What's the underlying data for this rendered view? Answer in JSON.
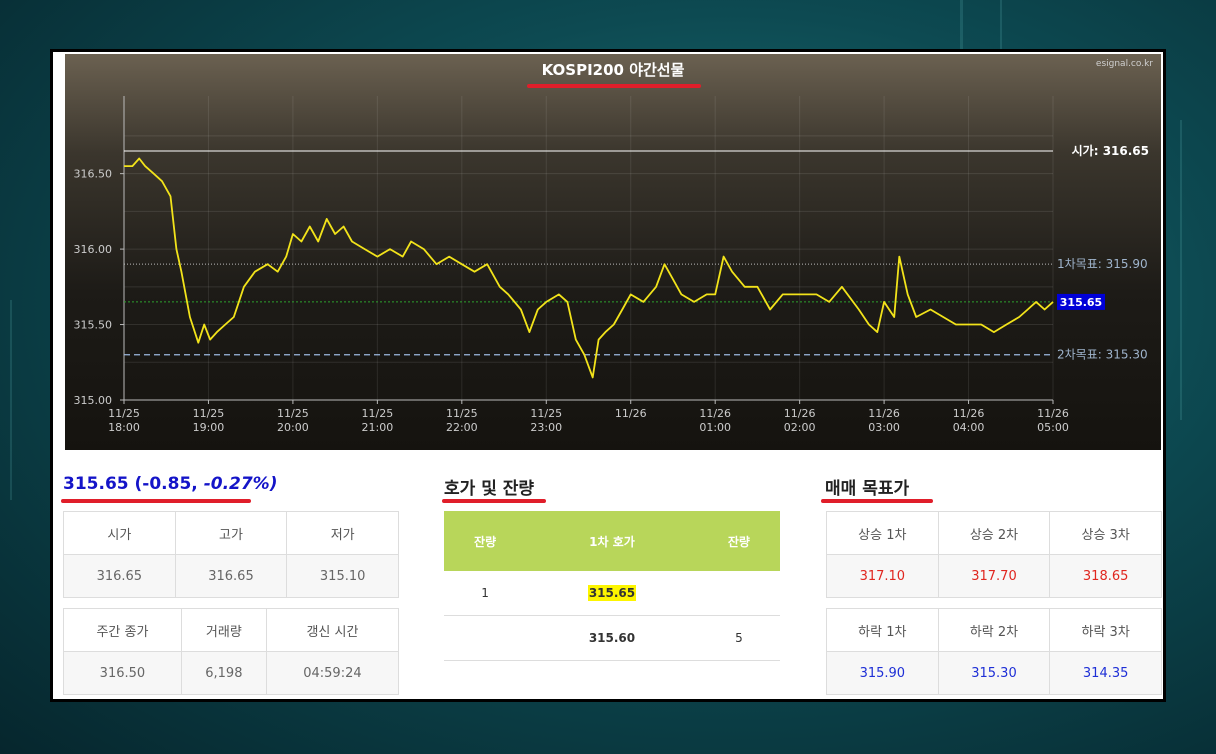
{
  "chart": {
    "title": "KOSPI200 야간선물",
    "source": "esignal.co.kr",
    "x_labels": [
      [
        "11/25",
        "18:00"
      ],
      [
        "11/25",
        "19:00"
      ],
      [
        "11/25",
        "20:00"
      ],
      [
        "11/25",
        "21:00"
      ],
      [
        "11/25",
        "22:00"
      ],
      [
        "11/25",
        "23:00"
      ],
      [
        "11/26",
        ""
      ],
      [
        "11/26",
        "01:00"
      ],
      [
        "11/26",
        "02:00"
      ],
      [
        "11/26",
        "03:00"
      ],
      [
        "11/26",
        "04:00"
      ],
      [
        "11/26",
        "05:00"
      ]
    ],
    "y_labels": [
      "316.50",
      "316.00",
      "315.50",
      "315.00"
    ],
    "ref_lines": {
      "open_label": "시가:",
      "open_value": "316.65",
      "target1_label": "1차목표:",
      "target1_value": "315.90",
      "target2_label": "2차목표:",
      "target2_value": "315.30",
      "current_badge": "315.65"
    },
    "colors": {
      "line": "#f2e31a",
      "current": "#0000d8",
      "open_line": "#ffffff",
      "target2_line": "#9cb8e0"
    }
  },
  "chart_data": {
    "type": "line",
    "title": "KOSPI200 야간선물",
    "x_range_hours": [
      18,
      29
    ],
    "ylim": [
      315.0,
      316.65
    ],
    "series": [
      {
        "values": [
          [
            18.0,
            316.55
          ],
          [
            18.1,
            316.55
          ],
          [
            18.18,
            316.6
          ],
          [
            18.25,
            316.55
          ],
          [
            18.35,
            316.5
          ],
          [
            18.45,
            316.45
          ],
          [
            18.55,
            316.35
          ],
          [
            18.62,
            316.0
          ],
          [
            18.68,
            315.85
          ],
          [
            18.78,
            315.55
          ],
          [
            18.88,
            315.38
          ],
          [
            18.95,
            315.5
          ],
          [
            19.02,
            315.4
          ],
          [
            19.1,
            315.45
          ],
          [
            19.2,
            315.5
          ],
          [
            19.3,
            315.55
          ],
          [
            19.42,
            315.75
          ],
          [
            19.55,
            315.85
          ],
          [
            19.7,
            315.9
          ],
          [
            19.82,
            315.85
          ],
          [
            19.92,
            315.95
          ],
          [
            20.0,
            316.1
          ],
          [
            20.1,
            316.05
          ],
          [
            20.2,
            316.15
          ],
          [
            20.3,
            316.05
          ],
          [
            20.4,
            316.2
          ],
          [
            20.5,
            316.1
          ],
          [
            20.6,
            316.15
          ],
          [
            20.7,
            316.05
          ],
          [
            20.85,
            316.0
          ],
          [
            21.0,
            315.95
          ],
          [
            21.15,
            316.0
          ],
          [
            21.3,
            315.95
          ],
          [
            21.4,
            316.05
          ],
          [
            21.55,
            316.0
          ],
          [
            21.7,
            315.9
          ],
          [
            21.85,
            315.95
          ],
          [
            22.0,
            315.9
          ],
          [
            22.15,
            315.85
          ],
          [
            22.3,
            315.9
          ],
          [
            22.45,
            315.75
          ],
          [
            22.55,
            315.7
          ],
          [
            22.7,
            315.6
          ],
          [
            22.8,
            315.45
          ],
          [
            22.9,
            315.6
          ],
          [
            23.0,
            315.65
          ],
          [
            23.15,
            315.7
          ],
          [
            23.25,
            315.65
          ],
          [
            23.35,
            315.4
          ],
          [
            23.45,
            315.3
          ],
          [
            23.55,
            315.15
          ],
          [
            23.62,
            315.4
          ],
          [
            23.7,
            315.45
          ],
          [
            23.8,
            315.5
          ],
          [
            23.9,
            315.6
          ],
          [
            24.0,
            315.7
          ],
          [
            24.15,
            315.65
          ],
          [
            24.3,
            315.75
          ],
          [
            24.4,
            315.9
          ],
          [
            24.5,
            315.8
          ],
          [
            24.6,
            315.7
          ],
          [
            24.75,
            315.65
          ],
          [
            24.9,
            315.7
          ],
          [
            25.0,
            315.7
          ],
          [
            25.1,
            315.95
          ],
          [
            25.2,
            315.85
          ],
          [
            25.35,
            315.75
          ],
          [
            25.5,
            315.75
          ],
          [
            25.65,
            315.6
          ],
          [
            25.8,
            315.7
          ],
          [
            26.0,
            315.7
          ],
          [
            26.2,
            315.7
          ],
          [
            26.35,
            315.65
          ],
          [
            26.5,
            315.75
          ],
          [
            26.7,
            315.6
          ],
          [
            26.82,
            315.5
          ],
          [
            26.92,
            315.45
          ],
          [
            27.0,
            315.65
          ],
          [
            27.12,
            315.55
          ],
          [
            27.18,
            315.95
          ],
          [
            27.28,
            315.7
          ],
          [
            27.38,
            315.55
          ],
          [
            27.55,
            315.6
          ],
          [
            27.7,
            315.55
          ],
          [
            27.85,
            315.5
          ],
          [
            28.0,
            315.5
          ],
          [
            28.15,
            315.5
          ],
          [
            28.3,
            315.45
          ],
          [
            28.45,
            315.5
          ],
          [
            28.6,
            315.55
          ],
          [
            28.7,
            315.6
          ],
          [
            28.8,
            315.65
          ],
          [
            28.9,
            315.6
          ],
          [
            29.0,
            315.65
          ]
        ]
      }
    ],
    "reference_lines": {
      "open": 316.65,
      "target1": 315.9,
      "target2": 315.3,
      "current": 315.65
    }
  },
  "summary": {
    "price": "315.65",
    "change": "(-0.85,",
    "pct": "-0.27%)"
  },
  "ohlc": {
    "headers": [
      "시가",
      "고가",
      "저가"
    ],
    "values": [
      "316.65",
      "316.65",
      "315.10"
    ]
  },
  "weekly": {
    "headers": [
      "주간 종가",
      "거래량",
      "갱신 시간"
    ],
    "values": [
      "316.50",
      "6,198",
      "04:59:24"
    ]
  },
  "orderbook": {
    "title": "호가 및 잔량",
    "headers": [
      "잔량",
      "1차 호가",
      "잔량"
    ],
    "rows": [
      {
        "left": "1",
        "price": "315.65",
        "right": ""
      },
      {
        "left": "",
        "price": "315.60",
        "right": "5"
      }
    ]
  },
  "targets": {
    "title": "매매 목표가",
    "up_headers": [
      "상승 1차",
      "상승 2차",
      "상승 3차"
    ],
    "up_values": [
      "317.10",
      "317.70",
      "318.65"
    ],
    "down_headers": [
      "하락 1차",
      "하락 2차",
      "하락 3차"
    ],
    "down_values": [
      "315.90",
      "315.30",
      "314.35"
    ]
  }
}
